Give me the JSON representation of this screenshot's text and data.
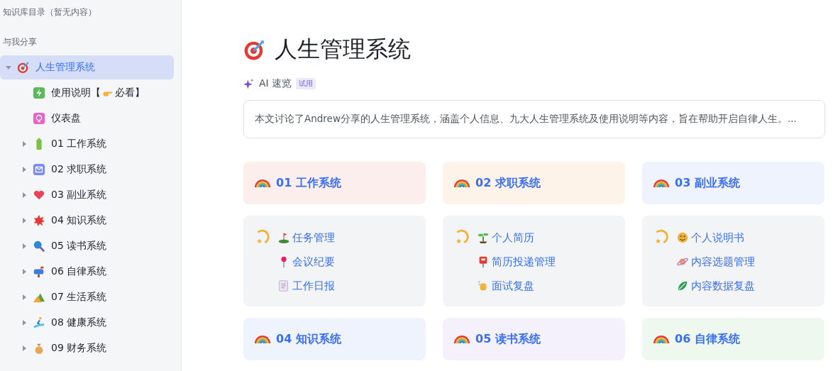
{
  "sidebar": {
    "directory_label": "知识库目录（暂无内容）",
    "shared_label": "与我分享",
    "tree": [
      {
        "label": "人生管理系统",
        "kind": "folder",
        "expanded": true,
        "selected": true,
        "children": [
          {
            "label": "使用说明【",
            "suffix": "必看】",
            "kind": "page",
            "selected": false
          },
          {
            "label": "仪表盘",
            "kind": "page",
            "selected": false
          },
          {
            "label": "01 工作系统",
            "kind": "folder",
            "expanded": false,
            "selected": false
          },
          {
            "label": "02 求职系统",
            "kind": "folder",
            "expanded": false,
            "selected": false
          },
          {
            "label": "03 副业系统",
            "kind": "folder",
            "expanded": false,
            "selected": false
          },
          {
            "label": "04 知识系统",
            "kind": "folder",
            "expanded": false,
            "selected": false
          },
          {
            "label": "05 读书系统",
            "kind": "folder",
            "expanded": false,
            "selected": false
          },
          {
            "label": "06 自律系统",
            "kind": "folder",
            "expanded": false,
            "selected": false
          },
          {
            "label": "07 生活系统",
            "kind": "folder",
            "expanded": false,
            "selected": false
          },
          {
            "label": "08 健康系统",
            "kind": "folder",
            "expanded": false,
            "selected": false
          },
          {
            "label": "09 财务系统",
            "kind": "folder",
            "expanded": false,
            "selected": false
          }
        ]
      }
    ]
  },
  "page": {
    "title": "人生管理系统",
    "ai": {
      "label": "AI 速览",
      "badge": "试用"
    },
    "summary": "本文讨论了Andrew分享的人生管理系统，涵盖个人信息、九大人生管理系统及使用说明等内容，旨在帮助开启自律人生。...",
    "cards": [
      {
        "kind": "header",
        "title": "01 工作系统",
        "color": "#fdeeee"
      },
      {
        "kind": "header",
        "title": "02 求职系统",
        "color": "#fef3e8"
      },
      {
        "kind": "header",
        "title": "03 副业系统",
        "color": "#eef3fd"
      },
      {
        "kind": "links",
        "links": [
          "任务管理",
          "会议纪要",
          "工作日报"
        ]
      },
      {
        "kind": "links",
        "links": [
          "个人简历",
          "简历投递管理",
          "面试复盘"
        ]
      },
      {
        "kind": "links",
        "links": [
          "个人说明书",
          "内容选题管理",
          "内容数据复盘"
        ]
      },
      {
        "kind": "header",
        "title": "04 知识系统",
        "color": "#eef3fd"
      },
      {
        "kind": "header",
        "title": "05 读书系统",
        "color": "#f4f1fd"
      },
      {
        "kind": "header",
        "title": "06 自律系统",
        "color": "#eef8ee"
      }
    ]
  }
}
